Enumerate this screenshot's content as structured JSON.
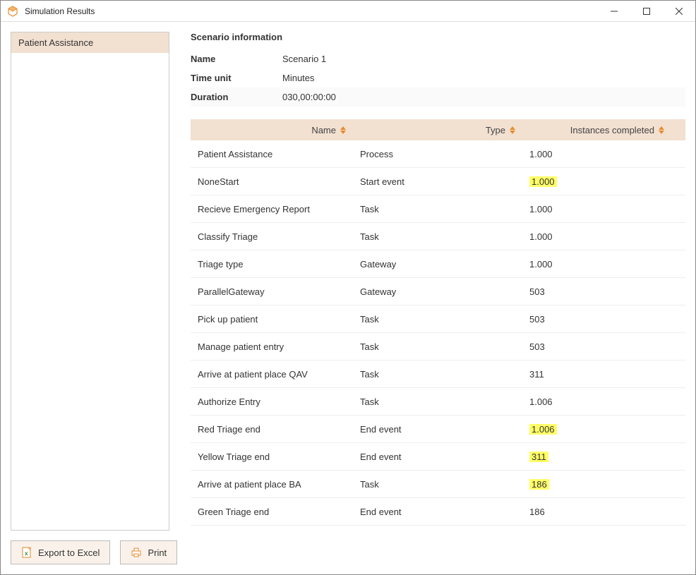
{
  "window": {
    "title": "Simulation Results"
  },
  "sidebar": {
    "items": [
      {
        "label": "Patient Assistance"
      }
    ]
  },
  "scenario": {
    "heading": "Scenario information",
    "rows": [
      {
        "label": "Name",
        "value": "Scenario 1"
      },
      {
        "label": "Time unit",
        "value": "Minutes"
      },
      {
        "label": "Duration",
        "value": "030,00:00:00"
      }
    ]
  },
  "table": {
    "columns": {
      "name": "Name",
      "type": "Type",
      "instances": "Instances completed"
    },
    "rows": [
      {
        "name": "Patient Assistance",
        "type": "Process",
        "instances": "1.000",
        "hl": false
      },
      {
        "name": "NoneStart",
        "type": "Start event",
        "instances": "1.000",
        "hl": true
      },
      {
        "name": "Recieve Emergency Report",
        "type": "Task",
        "instances": "1.000",
        "hl": false
      },
      {
        "name": "Classify Triage",
        "type": "Task",
        "instances": "1.000",
        "hl": false
      },
      {
        "name": "Triage type",
        "type": "Gateway",
        "instances": "1.000",
        "hl": false
      },
      {
        "name": "ParallelGateway",
        "type": "Gateway",
        "instances": "503",
        "hl": false
      },
      {
        "name": "Pick up patient",
        "type": "Task",
        "instances": "503",
        "hl": false
      },
      {
        "name": "Manage patient entry",
        "type": "Task",
        "instances": "503",
        "hl": false
      },
      {
        "name": "Arrive at patient place QAV",
        "type": "Task",
        "instances": "311",
        "hl": false
      },
      {
        "name": "Authorize Entry",
        "type": "Task",
        "instances": "1.006",
        "hl": false
      },
      {
        "name": "Red Triage end",
        "type": "End event",
        "instances": "1.006",
        "hl": true
      },
      {
        "name": "Yellow Triage end",
        "type": "End event",
        "instances": "311",
        "hl": true
      },
      {
        "name": "Arrive at patient place BA",
        "type": "Task",
        "instances": "186",
        "hl": true
      },
      {
        "name": "Green Triage end",
        "type": "End event",
        "instances": "186",
        "hl": false
      }
    ]
  },
  "buttons": {
    "export": "Export to Excel",
    "print": "Print"
  }
}
